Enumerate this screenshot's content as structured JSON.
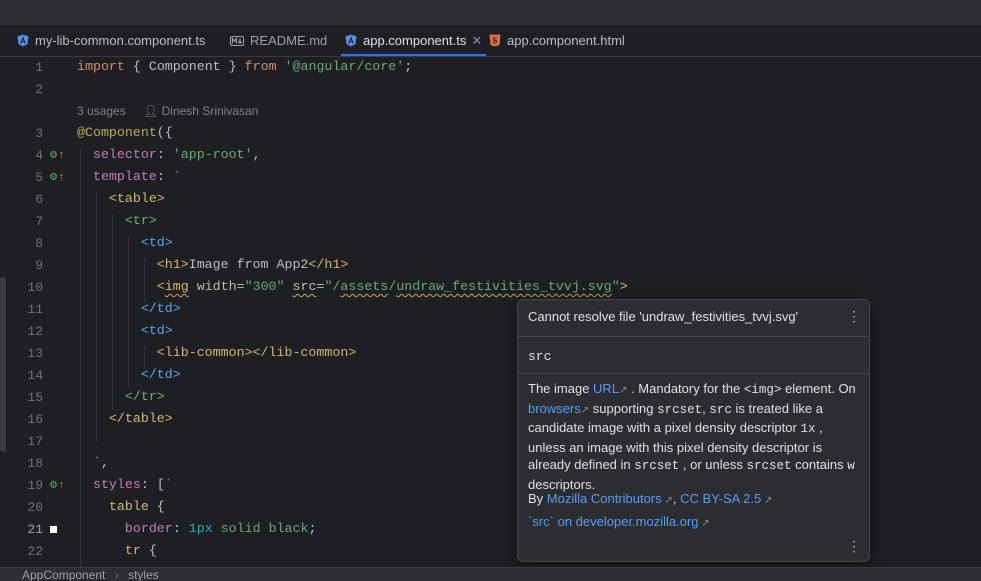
{
  "tabs": [
    {
      "label": "my-lib-common.component.ts",
      "icon": "angular-icon"
    },
    {
      "label": "README.md",
      "icon": "markdown-icon"
    },
    {
      "label": "app.component.ts",
      "icon": "angular-icon",
      "active": true
    },
    {
      "label": "app.component.html",
      "icon": "html5-icon"
    }
  ],
  "hint": {
    "usages": "3 usages",
    "author": "Dinesh Srinivasan"
  },
  "line_numbers": [
    "1",
    "2",
    "3",
    "4",
    "5",
    "6",
    "7",
    "8",
    "9",
    "10",
    "11",
    "12",
    "13",
    "14",
    "15",
    "16",
    "17",
    "18",
    "19",
    "20",
    "21",
    "22"
  ],
  "current_line": "21",
  "popup": {
    "title": "Cannot resolve file 'undraw_festivities_tvvj.svg'",
    "name": "src",
    "desc": {
      "p1": "The image",
      "url": "URL",
      "p2": ". Mandatory for the",
      "img": "<img>",
      "p3": "element. On",
      "browsers": "browsers",
      "p4": "supporting",
      "srcset1": "srcset",
      "comma": ",",
      "src": "src",
      "p5": "is treated like a candidate image with a pixel density descriptor",
      "onex": "1x",
      "p6": ", unless an image with this pixel density descriptor is already defined in",
      "srcset2": "srcset",
      "p7": ", or unless",
      "srcset3": "srcset",
      "p8": "contains",
      "w": "w",
      "p9": "descriptors."
    },
    "by": "By",
    "contributors": "Mozilla Contributors",
    "license": "CC BY-SA 2.5",
    "mdn_link": "`src` on developer.mozilla.org"
  },
  "statusbar": {
    "class": "AppComponent",
    "member": "styles"
  }
}
